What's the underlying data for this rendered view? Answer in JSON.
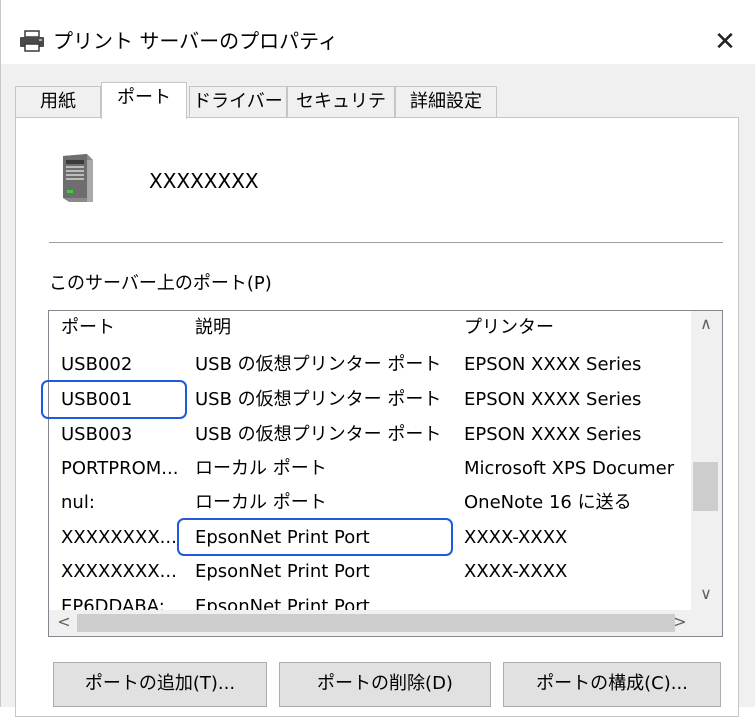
{
  "window": {
    "title": "プリント サーバーのプロパティ",
    "close_glyph": "✕"
  },
  "tabs": [
    {
      "label": "用紙"
    },
    {
      "label": "ポート"
    },
    {
      "label": "ドライバー"
    },
    {
      "label": "セキュリティ"
    },
    {
      "label": "詳細設定"
    }
  ],
  "server": {
    "name": "XXXXXXXX",
    "icon": "server-icon"
  },
  "ports_section": {
    "label": "このサーバー上のポート(P)"
  },
  "ports_table": {
    "headers": [
      "ポート",
      "説明",
      "プリンター"
    ],
    "rows": [
      {
        "port": "USB002",
        "desc": "USB の仮想プリンター ポート",
        "printer": "EPSON XXXX Series"
      },
      {
        "port": "USB001",
        "desc": "USB の仮想プリンター ポート",
        "printer": "EPSON XXXX Series"
      },
      {
        "port": "USB003",
        "desc": "USB の仮想プリンター ポート",
        "printer": "EPSON XXXX Series"
      },
      {
        "port": "PORTPROM...",
        "desc": "ローカル ポート",
        "printer": "Microsoft XPS Documer"
      },
      {
        "port": "nul:",
        "desc": "ローカル ポート",
        "printer": "OneNote 16 に送る"
      },
      {
        "port": "XXXXXXXX...",
        "desc": "EpsonNet Print Port",
        "printer": "XXXX-XXXX"
      },
      {
        "port": "XXXXXXXX...",
        "desc": "EpsonNet Print Port",
        "printer": "XXXX-XXXX"
      },
      {
        "port": "EP6DDABA:",
        "desc": "EpsonNet Print Port",
        "printer": ""
      }
    ]
  },
  "scrollbar": {
    "up": "∧",
    "down": "∨",
    "left": "<",
    "right": ">"
  },
  "buttons": {
    "add": "ポートの追加(T)...",
    "delete": "ポートの削除(D)",
    "configure": "ポートの構成(C)..."
  },
  "colors": {
    "highlight": "#1f5bd8",
    "dialog_bg": "#f0f0f0"
  }
}
